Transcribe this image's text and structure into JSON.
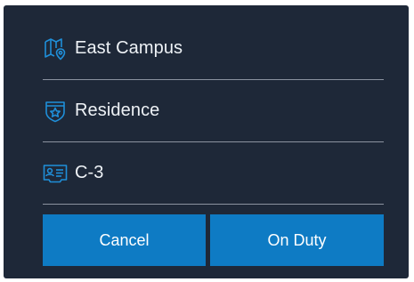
{
  "details": {
    "campus_label": "East Campus",
    "campus_icon": "map-pin-icon",
    "building_label": "Residence",
    "building_icon": "badge-star-icon",
    "post_label": "C-3",
    "post_icon": "id-card-icon"
  },
  "actions": {
    "cancel_label": "Cancel",
    "on_duty_label": "On Duty"
  },
  "colors": {
    "panel_bg": "#1e2838",
    "accent": "#0e7bc4",
    "icon_blue": "#1f8fd9",
    "divider": "#8b93a0",
    "text": "#eef2f6"
  }
}
